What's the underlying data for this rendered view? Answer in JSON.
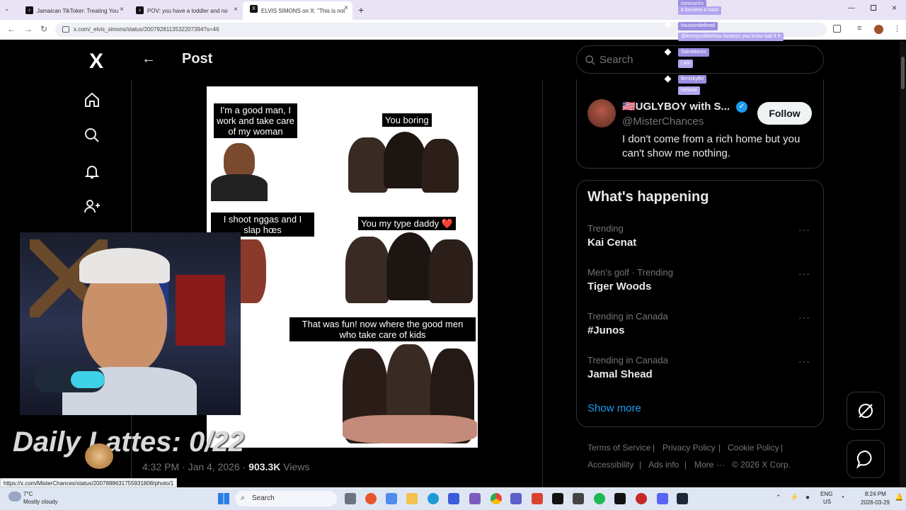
{
  "browser": {
    "tabs": [
      {
        "title": "Jamaican TikToker: Treating You"
      },
      {
        "title": "POV: you have a toddler and no"
      },
      {
        "title": "ELVIS SIMONS on X: \"This is not"
      }
    ],
    "new_tab": "+",
    "url": "x.com/_elvis_simons/status/2007928113532207394?s=46"
  },
  "nav": {
    "logo": "X"
  },
  "post": {
    "header_title": "Post",
    "timestamp_text": "4:32 PM · Jan 4, 2026 · ",
    "views_count": "903.3K",
    "views_label": " Views",
    "meme": {
      "caption1": "I'm a good man, I work and take care of my woman",
      "caption2": "You boring",
      "caption3": "I shoot nggas and I slap hœs",
      "caption4": "You my type daddy ❤️",
      "caption5": "That was fun! now where the good men who take care of kids"
    }
  },
  "sidebar": {
    "search_placeholder": "Search",
    "who_to_follow": {
      "display_name": "🇱🇷UGLYBOY with S...",
      "verified_mark": "✓",
      "handle": "@MisterChances",
      "bio": "I don't come from a rich home but you can't show me nothing.",
      "follow_label": "Follow"
    },
    "whats_happening": {
      "title": "What's happening",
      "trends": [
        {
          "context": "Trending",
          "name": "Kai Cenat"
        },
        {
          "context": "Men's golf · Trending",
          "name": "Tiger Woods"
        },
        {
          "context": "Trending in Canada",
          "name": "#Junos"
        },
        {
          "context": "Trending in Canada",
          "name": "Jamal Shead"
        }
      ],
      "more_dots": "···",
      "show_more": "Show more"
    },
    "footer": {
      "terms": "Terms of Service",
      "privacy": "Privacy Policy",
      "cookie": "Cookie Policy",
      "accessibility": "Accessibility",
      "ads": "Ads info",
      "more": "More ···",
      "copyright": "© 2026 X Corp."
    }
  },
  "chat": [
    {
      "user": "itsHoseXo",
      "msg": "it become a habit"
    },
    {
      "user": "houstondefined",
      "msg": "@kennycobbshow factssss you know ball fr fr"
    },
    {
      "user": "Salvationzs",
      "msg": "i am"
    },
    {
      "user": "BrrrizkyBri",
      "msg": "hellooo"
    }
  ],
  "stream": {
    "lattes_text": "Daily Lattes: 0/22"
  },
  "status_url": "https://x.com/MisterChances/status/2007888631755931808/photo/1",
  "taskbar": {
    "weather_temp": "7°C",
    "weather_desc": "Mostly cloudy",
    "search_label": "Search",
    "lang_top": "ENG",
    "lang_bottom": "US",
    "time": "8:24 PM",
    "date": "2026-03-29"
  },
  "colors": {
    "accent_blue": "#1d9bf0",
    "chat_name_bg": "#9a8ce0",
    "tab_bar_bg": "#e9e3f5"
  }
}
